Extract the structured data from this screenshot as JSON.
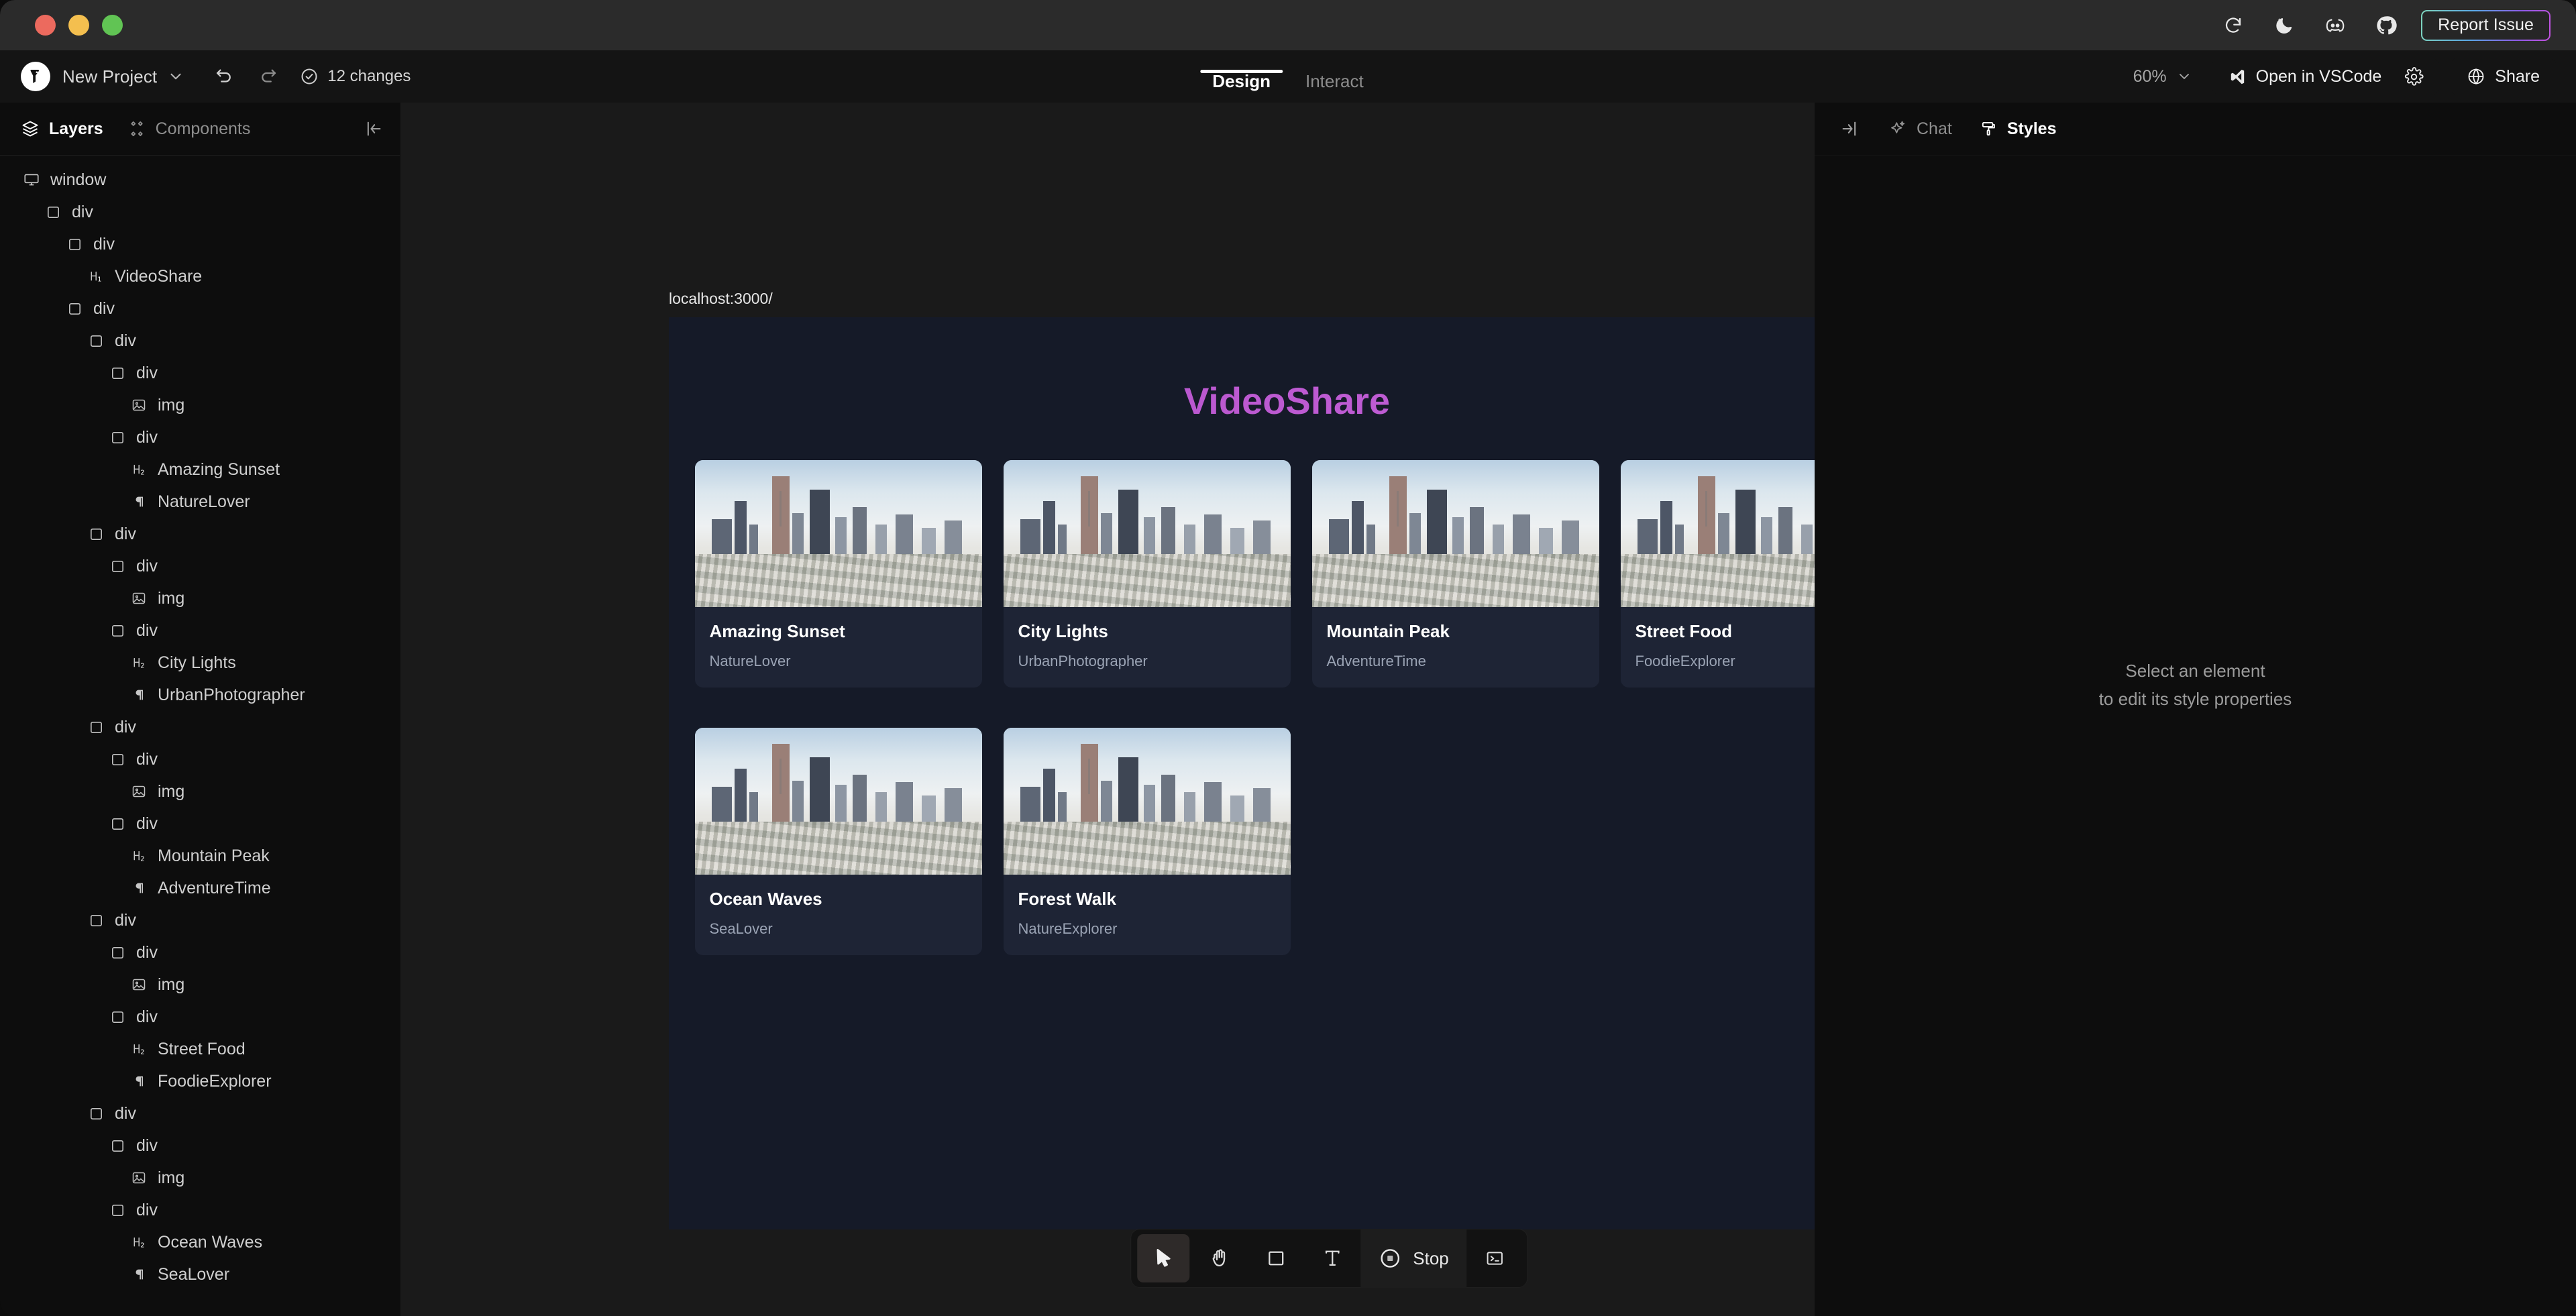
{
  "titlebar": {
    "icons": [
      "refresh-icon",
      "moon-stars-icon",
      "discord-icon",
      "github-icon"
    ],
    "report_issue_label": "Report Issue"
  },
  "toolbar": {
    "project_name": "New Project",
    "undo_icon": "undo-icon",
    "redo_icon": "redo-icon",
    "changes_label": "12 changes",
    "tabs": [
      {
        "label": "Design",
        "active": true
      },
      {
        "label": "Interact",
        "active": false
      }
    ],
    "zoom_level": "60%",
    "open_vscode_label": "Open in VSCode",
    "settings_icon": "gear-icon",
    "share_label": "Share"
  },
  "left_panel": {
    "tabs": [
      {
        "label": "Layers",
        "icon": "layers-icon",
        "active": true
      },
      {
        "label": "Components",
        "icon": "components-icon",
        "active": false
      }
    ],
    "collapse_icon": "collapse-left-icon",
    "tree": [
      {
        "label": "window",
        "icon": "window",
        "depth": 0
      },
      {
        "label": "div",
        "icon": "div",
        "depth": 1
      },
      {
        "label": "div",
        "icon": "div",
        "depth": 2
      },
      {
        "label": "VideoShare",
        "icon": "h1",
        "depth": 3
      },
      {
        "label": "div",
        "icon": "div",
        "depth": 2
      },
      {
        "label": "div",
        "icon": "div",
        "depth": 3
      },
      {
        "label": "div",
        "icon": "div",
        "depth": 4
      },
      {
        "label": "img",
        "icon": "img",
        "depth": 5
      },
      {
        "label": "div",
        "icon": "div",
        "depth": 4
      },
      {
        "label": "Amazing Sunset",
        "icon": "h2",
        "depth": 5
      },
      {
        "label": "NatureLover",
        "icon": "p",
        "depth": 5
      },
      {
        "label": "div",
        "icon": "div",
        "depth": 3
      },
      {
        "label": "div",
        "icon": "div",
        "depth": 4
      },
      {
        "label": "img",
        "icon": "img",
        "depth": 5
      },
      {
        "label": "div",
        "icon": "div",
        "depth": 4
      },
      {
        "label": "City Lights",
        "icon": "h2",
        "depth": 5
      },
      {
        "label": "UrbanPhotographer",
        "icon": "p",
        "depth": 5
      },
      {
        "label": "div",
        "icon": "div",
        "depth": 3
      },
      {
        "label": "div",
        "icon": "div",
        "depth": 4
      },
      {
        "label": "img",
        "icon": "img",
        "depth": 5
      },
      {
        "label": "div",
        "icon": "div",
        "depth": 4
      },
      {
        "label": "Mountain Peak",
        "icon": "h2",
        "depth": 5
      },
      {
        "label": "AdventureTime",
        "icon": "p",
        "depth": 5
      },
      {
        "label": "div",
        "icon": "div",
        "depth": 3
      },
      {
        "label": "div",
        "icon": "div",
        "depth": 4
      },
      {
        "label": "img",
        "icon": "img",
        "depth": 5
      },
      {
        "label": "div",
        "icon": "div",
        "depth": 4
      },
      {
        "label": "Street Food",
        "icon": "h2",
        "depth": 5
      },
      {
        "label": "FoodieExplorer",
        "icon": "p",
        "depth": 5
      },
      {
        "label": "div",
        "icon": "div",
        "depth": 3
      },
      {
        "label": "div",
        "icon": "div",
        "depth": 4
      },
      {
        "label": "img",
        "icon": "img",
        "depth": 5
      },
      {
        "label": "div",
        "icon": "div",
        "depth": 4
      },
      {
        "label": "Ocean Waves",
        "icon": "h2",
        "depth": 5
      },
      {
        "label": "SeaLover",
        "icon": "p",
        "depth": 5
      }
    ]
  },
  "canvas": {
    "frame_url": "localhost:3000/",
    "frame_dropdown_icon": "chevron-down-icon",
    "preview": {
      "site_title": "VideoShare",
      "title_color": "#c155d4",
      "background_color": "#151a28",
      "card_background_color": "#1e2435",
      "cards": [
        {
          "title": "Amazing Sunset",
          "author": "NatureLover"
        },
        {
          "title": "City Lights",
          "author": "UrbanPhotographer"
        },
        {
          "title": "Mountain Peak",
          "author": "AdventureTime"
        },
        {
          "title": "Street Food",
          "author": "FoodieExplorer"
        },
        {
          "title": "Ocean Waves",
          "author": "SeaLover"
        },
        {
          "title": "Forest Walk",
          "author": "NatureExplorer"
        }
      ]
    }
  },
  "bottom_toolbar": {
    "tools": [
      {
        "name": "cursor-tool",
        "icon": "cursor-icon",
        "selected": true
      },
      {
        "name": "hand-tool",
        "icon": "hand-icon",
        "selected": false
      },
      {
        "name": "rectangle-tool",
        "icon": "rectangle-icon",
        "selected": false
      },
      {
        "name": "text-tool",
        "icon": "text-icon",
        "selected": false
      }
    ],
    "stop_label": "Stop",
    "stop_icon": "record-stop-icon",
    "terminal_icon": "terminal-icon"
  },
  "right_panel": {
    "collapse_icon": "collapse-right-icon",
    "tabs": [
      {
        "label": "Chat",
        "icon": "sparkle-icon",
        "active": false
      },
      {
        "label": "Styles",
        "icon": "paint-roller-icon",
        "active": true
      }
    ],
    "empty_line_1": "Select an element",
    "empty_line_2": "to edit its style properties"
  }
}
